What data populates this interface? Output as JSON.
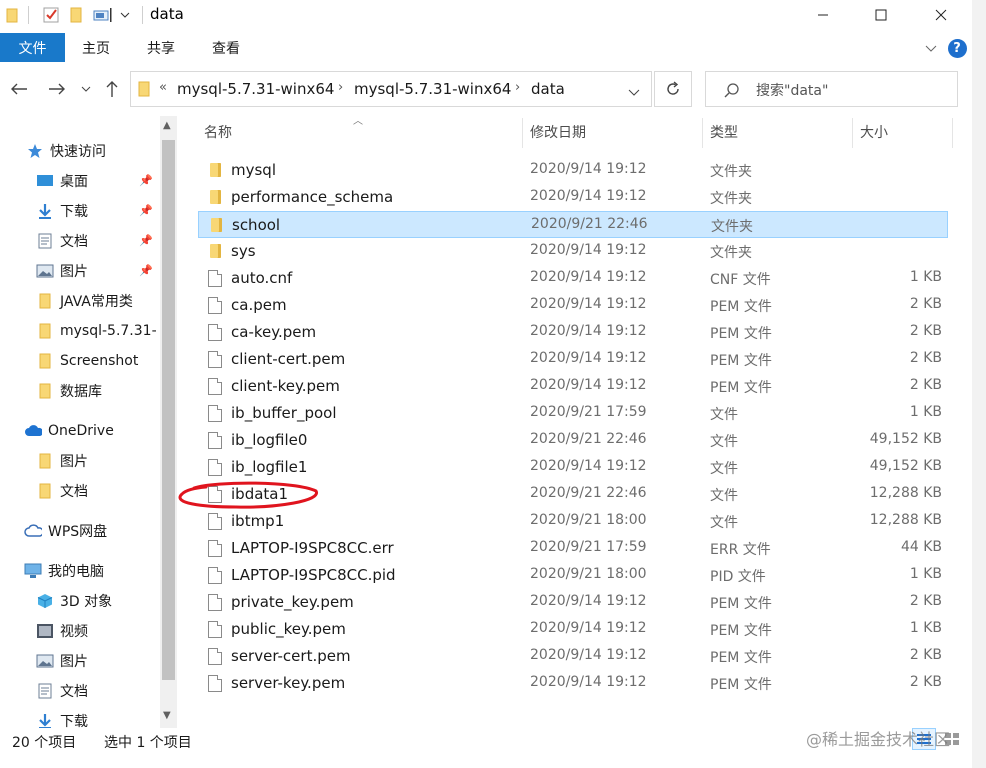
{
  "window": {
    "title": "data",
    "minimize": "—",
    "maximize": "☐",
    "close": "✕"
  },
  "ribbon": {
    "file": "文件",
    "home": "主页",
    "share": "共享",
    "view": "查看",
    "expand": "⌄",
    "help": "?"
  },
  "address": {
    "prefix": "«",
    "crumbs": [
      "mysql-5.7.31-winx64",
      "mysql-5.7.31-winx64",
      "data"
    ],
    "search_placeholder": "搜索\"data\""
  },
  "nav": {
    "items": [
      {
        "label": "快速访问",
        "icon": "star-icon"
      },
      {
        "label": "桌面",
        "icon": "desktop-icon",
        "pinned": true
      },
      {
        "label": "下载",
        "icon": "download-icon",
        "pinned": true
      },
      {
        "label": "文档",
        "icon": "document-icon",
        "pinned": true
      },
      {
        "label": "图片",
        "icon": "picture-icon",
        "pinned": true
      },
      {
        "label": "JAVA常用类",
        "icon": "folder-icon"
      },
      {
        "label": "mysql-5.7.31-",
        "icon": "folder-icon"
      },
      {
        "label": "Screenshot",
        "icon": "folder-icon"
      },
      {
        "label": "数据库",
        "icon": "folder-icon"
      },
      {
        "label": "OneDrive",
        "icon": "cloud-icon"
      },
      {
        "label": "图片",
        "icon": "folder-icon"
      },
      {
        "label": "文档",
        "icon": "folder-icon"
      },
      {
        "label": "WPS网盘",
        "icon": "wps-cloud-icon"
      },
      {
        "label": "我的电脑",
        "icon": "computer-icon"
      },
      {
        "label": "3D 对象",
        "icon": "3d-object-icon"
      },
      {
        "label": "视频",
        "icon": "video-icon"
      },
      {
        "label": "图片",
        "icon": "picture-icon"
      },
      {
        "label": "文档",
        "icon": "document-icon"
      },
      {
        "label": "下载",
        "icon": "download-icon"
      }
    ]
  },
  "columns": {
    "name": "名称",
    "modified": "修改日期",
    "type": "类型",
    "size": "大小"
  },
  "files": [
    {
      "name": "mysql",
      "date": "2020/9/14 19:12",
      "type": "文件夹",
      "size": "",
      "kind": "folder"
    },
    {
      "name": "performance_schema",
      "date": "2020/9/14 19:12",
      "type": "文件夹",
      "size": "",
      "kind": "folder"
    },
    {
      "name": "school",
      "date": "2020/9/21 22:46",
      "type": "文件夹",
      "size": "",
      "kind": "folder",
      "selected": true
    },
    {
      "name": "sys",
      "date": "2020/9/14 19:12",
      "type": "文件夹",
      "size": "",
      "kind": "folder"
    },
    {
      "name": "auto.cnf",
      "date": "2020/9/14 19:12",
      "type": "CNF 文件",
      "size": "1 KB",
      "kind": "file"
    },
    {
      "name": "ca.pem",
      "date": "2020/9/14 19:12",
      "type": "PEM 文件",
      "size": "2 KB",
      "kind": "file"
    },
    {
      "name": "ca-key.pem",
      "date": "2020/9/14 19:12",
      "type": "PEM 文件",
      "size": "2 KB",
      "kind": "file"
    },
    {
      "name": "client-cert.pem",
      "date": "2020/9/14 19:12",
      "type": "PEM 文件",
      "size": "2 KB",
      "kind": "file"
    },
    {
      "name": "client-key.pem",
      "date": "2020/9/14 19:12",
      "type": "PEM 文件",
      "size": "2 KB",
      "kind": "file"
    },
    {
      "name": "ib_buffer_pool",
      "date": "2020/9/21 17:59",
      "type": "文件",
      "size": "1 KB",
      "kind": "file"
    },
    {
      "name": "ib_logfile0",
      "date": "2020/9/21 22:46",
      "type": "文件",
      "size": "49,152 KB",
      "kind": "file"
    },
    {
      "name": "ib_logfile1",
      "date": "2020/9/14 19:12",
      "type": "文件",
      "size": "49,152 KB",
      "kind": "file"
    },
    {
      "name": "ibdata1",
      "date": "2020/9/21 22:46",
      "type": "文件",
      "size": "12,288 KB",
      "kind": "file"
    },
    {
      "name": "ibtmp1",
      "date": "2020/9/21 18:00",
      "type": "文件",
      "size": "12,288 KB",
      "kind": "file"
    },
    {
      "name": "LAPTOP-I9SPC8CC.err",
      "date": "2020/9/21 17:59",
      "type": "ERR 文件",
      "size": "44 KB",
      "kind": "file"
    },
    {
      "name": "LAPTOP-I9SPC8CC.pid",
      "date": "2020/9/21 18:00",
      "type": "PID 文件",
      "size": "1 KB",
      "kind": "file"
    },
    {
      "name": "private_key.pem",
      "date": "2020/9/14 19:12",
      "type": "PEM 文件",
      "size": "2 KB",
      "kind": "file"
    },
    {
      "name": "public_key.pem",
      "date": "2020/9/14 19:12",
      "type": "PEM 文件",
      "size": "1 KB",
      "kind": "file"
    },
    {
      "name": "server-cert.pem",
      "date": "2020/9/14 19:12",
      "type": "PEM 文件",
      "size": "2 KB",
      "kind": "file"
    },
    {
      "name": "server-key.pem",
      "date": "2020/9/14 19:12",
      "type": "PEM 文件",
      "size": "2 KB",
      "kind": "file"
    }
  ],
  "status": {
    "count": "20 个项目",
    "selected": "选中 1 个项目"
  },
  "watermark": "@稀土掘金技术社区",
  "colors": {
    "accent": "#1979ca",
    "selection": "#cce8ff",
    "annotation": "#e0141e"
  }
}
